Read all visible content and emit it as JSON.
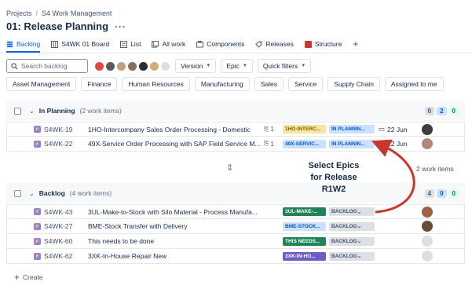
{
  "breadcrumb": {
    "root": "Projects",
    "project": "S4 Work Management"
  },
  "page": {
    "title": "01: Release Planning",
    "more": "···"
  },
  "tabs": [
    {
      "label": "Backlog",
      "active": true,
      "icon": "backlog-icon"
    },
    {
      "label": "S4WK 01 Board",
      "icon": "board-icon"
    },
    {
      "label": "List",
      "icon": "list-icon"
    },
    {
      "label": "All work",
      "icon": "all-work-icon"
    },
    {
      "label": "Components",
      "icon": "components-icon"
    },
    {
      "label": "Releases",
      "icon": "releases-icon"
    },
    {
      "label": "Structure",
      "icon": "structure-icon"
    }
  ],
  "search": {
    "placeholder": "Search backlog"
  },
  "filters": {
    "version": "Version",
    "epic": "Epic",
    "quick": "Quick filters"
  },
  "chips": [
    "Asset Management",
    "Finance",
    "Human Resources",
    "Manufacturing",
    "Sales",
    "Service",
    "Supply Chain",
    "Assigned to me"
  ],
  "planning": {
    "title": "In Planning",
    "count": "(2 work items)",
    "counters": {
      "todo": "0",
      "progress": "2",
      "done": "0"
    },
    "rows": [
      {
        "key": "S4WK-19",
        "summary": "1HO-Intercompany Sales Order Processing - Domestic",
        "children": "1",
        "epic": "1HO-INTERC...",
        "epic_color": "#f8e6a0",
        "epic_text": "#7f5f01",
        "status": "IN PLANNIN...",
        "date": "22 Jun"
      },
      {
        "key": "S4WK-22",
        "summary": "49X-Service Order Processing with SAP Field Service M...",
        "children": "1",
        "epic": "49X-SERVIC...",
        "epic_color": "#cce0ff",
        "epic_text": "#0055cc",
        "status": "IN PLANNIN...",
        "date": "22 Jun"
      }
    ]
  },
  "backlog": {
    "title": "Backlog",
    "count": "(4 work items)",
    "counters": {
      "todo": "4",
      "progress": "0",
      "done": "0"
    },
    "rows": [
      {
        "key": "S4WK-43",
        "summary": "3UL-Make-to-Stock with Silo Material - Process Manufa...",
        "epic": "3UL-MAKE-...",
        "epic_color": "#1f845a",
        "epic_text": "#ffffff",
        "status": "BACKLOG"
      },
      {
        "key": "S4WK-27",
        "summary": "BME-Stock Transfer with Delivery",
        "epic": "BME-STOCK...",
        "epic_color": "#cce0ff",
        "epic_text": "#0055cc",
        "status": "BACKLOG"
      },
      {
        "key": "S4WK-60",
        "summary": "This needs to be done",
        "epic": "THIS NEEDS...",
        "epic_color": "#1f845a",
        "epic_text": "#ffffff",
        "status": "BACKLOG"
      },
      {
        "key": "S4WK-62",
        "summary": "3XK-In-House Repair New",
        "epic": "3XK-IN-HO...",
        "epic_color": "#6e5dc6",
        "epic_text": "#ffffff",
        "status": "BACKLOG"
      }
    ]
  },
  "create_label": "Create",
  "annotation": {
    "line1": "Select Epics",
    "line2": "for Release",
    "line3": "R1W2"
  },
  "overlay_fragment": "2 work items",
  "colors": {
    "accent": "#0c66e4",
    "arrow": "#c9372c"
  }
}
